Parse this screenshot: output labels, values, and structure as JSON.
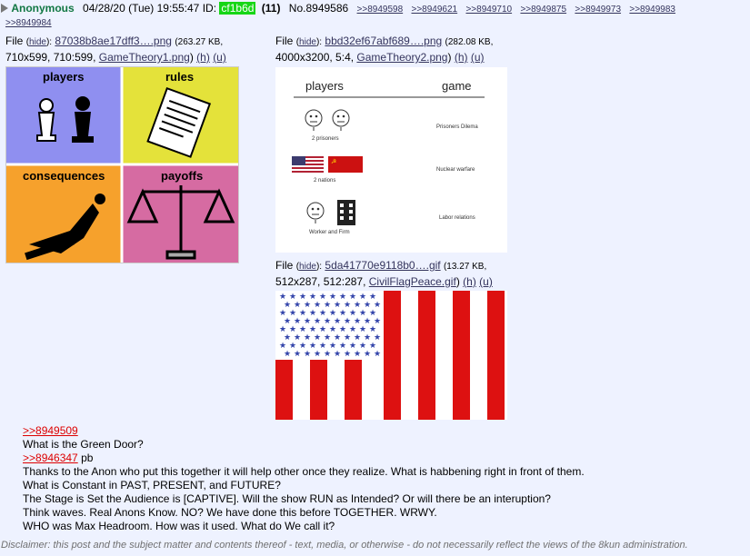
{
  "post": {
    "name": "Anonymous",
    "date": "04/28/20 (Tue) 19:55:47",
    "id_label": "ID:",
    "id": "cf1b6d",
    "id_count": "(11)",
    "number": "No.8949586",
    "backlinks": [
      ">>8949598",
      ">>8949621",
      ">>8949710",
      ">>8949875",
      ">>8949973",
      ">>8949983",
      ">>8949984"
    ]
  },
  "files": [
    {
      "label": "File",
      "hide": "hide",
      "name": "87038b8ae17dff3….png",
      "size": "(263.27 KB,",
      "dims": "710x599, 710:599,",
      "orig": "GameTheory1.png",
      "h": "(h)",
      "u": "(u)"
    },
    {
      "label": "File",
      "hide": "hide",
      "name": "bbd32ef67abf689….png",
      "size": "(282.08 KB,",
      "dims": "4000x3200, 5:4,",
      "orig": "GameTheory2.png",
      "h": "(h)",
      "u": "(u)"
    },
    {
      "label": "File",
      "hide": "hide",
      "name": "5da41770e9118b0….gif",
      "size": "(13.27 KB,",
      "dims": "512x287, 512:287,",
      "orig": "CivilFlagPeace.gif",
      "h": "(h)",
      "u": "(u)"
    }
  ],
  "image1": {
    "players": "players",
    "rules": "rules",
    "consequences": "consequences",
    "payoffs": "payoffs",
    "colors": {
      "players": "#8f8ff0",
      "rules": "#e4e23a",
      "consequences": "#f6a12c",
      "payoffs": "#d66ba2"
    }
  },
  "image2": {
    "col_players": "players",
    "col_game": "game",
    "rows": [
      {
        "caption": "2 prisoners",
        "game": "Prisoners Dilema"
      },
      {
        "caption": "2 nations",
        "game": "Nuclear warfare"
      },
      {
        "caption": "Worker and Firm",
        "game": "Labor relations"
      }
    ]
  },
  "message": {
    "lines": [
      {
        "type": "quote",
        "text": ">>8949509"
      },
      {
        "type": "text",
        "text": "What is the Green Door?"
      },
      {
        "type": "quote",
        "text": ">>8946347",
        "suffix": " pb"
      },
      {
        "type": "text",
        "text": "Thanks to the Anon who put this together it will help other once they realize. What is habbening right in front of them."
      },
      {
        "type": "text",
        "text": "What is Constant in PAST, PRESENT, and FUTURE?"
      },
      {
        "type": "text",
        "text": "The Stage is Set the Audience is [CAPTIVE]. Will the show RUN as Intended? Or will there be an interuption?"
      },
      {
        "type": "text",
        "text": "Think waves. Real Anons Know. NO? We have done this before TOGETHER. WRWY."
      },
      {
        "type": "text",
        "text": "WHO was Max Headroom. How was it used. What do We call it?"
      }
    ]
  },
  "disclaimer": "Disclaimer: this post and the subject matter and contents thereof - text, media, or otherwise - do not necessarily reflect the views of the 8kun administration."
}
